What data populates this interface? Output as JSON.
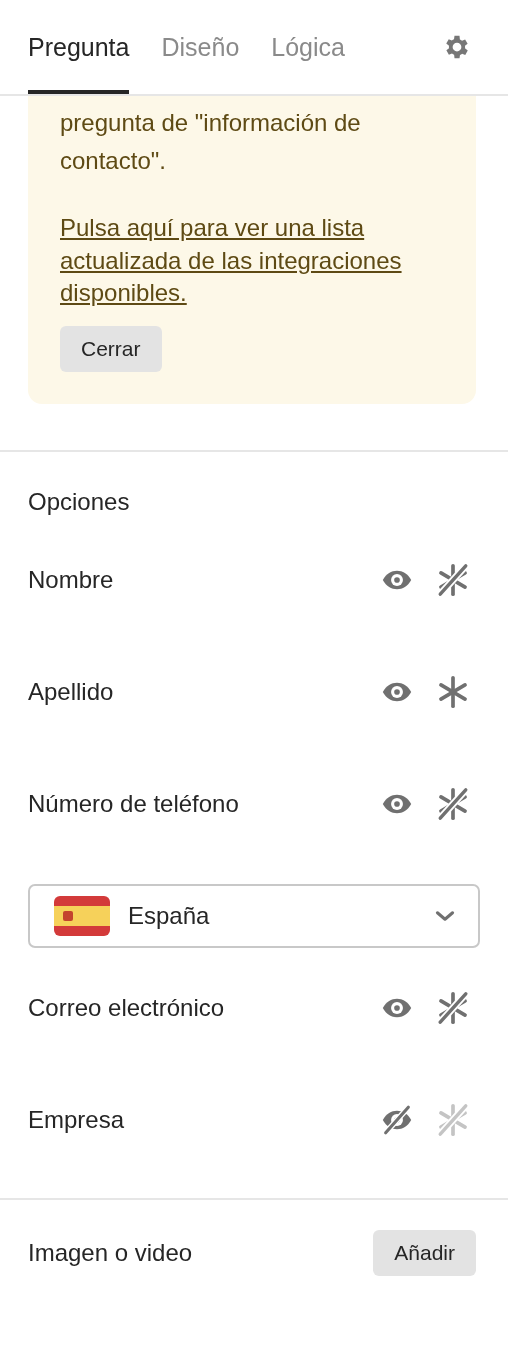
{
  "tabs": [
    {
      "label": "Pregunta",
      "selected": true
    },
    {
      "label": "Diseño",
      "selected": false
    },
    {
      "label": "Lógica",
      "selected": false
    }
  ],
  "notice": {
    "text": "pregunta de \"información de contacto\".",
    "link": "Pulsa aquí para ver una lista actualizada de las integraciones disponibles.",
    "button": "Cerrar"
  },
  "options": {
    "title": "Opciones",
    "items": [
      {
        "kind": "field",
        "label": "Nombre",
        "visible": true,
        "required": false,
        "disabled": false
      },
      {
        "kind": "field",
        "label": "Apellido",
        "visible": true,
        "required": true,
        "disabled": false
      },
      {
        "kind": "field",
        "label": "Número de teléfono",
        "visible": true,
        "required": false,
        "disabled": false
      },
      {
        "kind": "country",
        "value": "España"
      },
      {
        "kind": "field",
        "label": "Correo electrónico",
        "visible": true,
        "required": false,
        "disabled": false
      },
      {
        "kind": "field",
        "label": "Empresa",
        "visible": false,
        "required": false,
        "disabled": true
      }
    ]
  },
  "media": {
    "label": "Imagen o video",
    "button": "Añadir"
  }
}
